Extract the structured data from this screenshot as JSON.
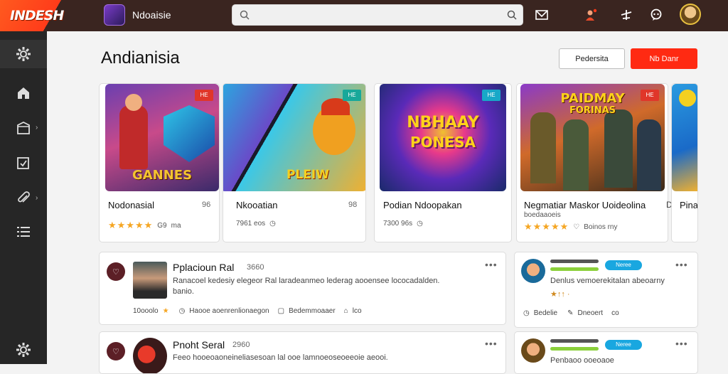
{
  "header": {
    "logo_text": "INDESH",
    "app_name": "Ndoaisie",
    "search": {
      "placeholder": ""
    }
  },
  "sidebar": {
    "items": [
      {
        "icon": "gear-icon"
      },
      {
        "icon": "home-icon"
      },
      {
        "icon": "folder-icon"
      },
      {
        "icon": "tasks-icon"
      },
      {
        "icon": "paperclip-icon"
      },
      {
        "icon": "list-icon"
      },
      {
        "icon": "settings-icon"
      }
    ]
  },
  "page": {
    "title": "Andianisia",
    "btn_secondary": "Pedersita",
    "btn_primary": "Nb Danr"
  },
  "cards": [
    {
      "title": "Nodonasial",
      "num": "96",
      "badge": "HE",
      "badge_color": "#e0362a",
      "art": "GANNES",
      "rating_label": "G9",
      "meta": "ma",
      "stars": "★★★★★"
    },
    {
      "title": "Nkooatian",
      "num": "98",
      "badge": "HE",
      "badge_color": "#18a89a",
      "art": "PLEIW",
      "meta": "7961 eos"
    },
    {
      "title": "Podian Ndoopakan",
      "badge": "HE",
      "badge_color": "#18a8c8",
      "art_line1": "NBHAAY",
      "art_line2": "PONESA",
      "meta": "7300 96s"
    },
    {
      "title": "Negmatiar Maskor Uoideolina",
      "sub": "boedaaoeis",
      "num": "D",
      "badge": "HE",
      "badge_color": "#e0362a",
      "art_line1": "PAIDMAY",
      "art_line2": "FORINAS",
      "meta": "Boinos rny",
      "stars": "★★★★★"
    },
    {
      "title": "Pina"
    }
  ],
  "posts": [
    {
      "title": "Pplacioun Ral",
      "num": "3660",
      "text_line1": "Ranacoel kedesiy elegeor Ral laradeanmeo lederag aooensee lococadalden.",
      "text_line2": "banio.",
      "stat": "10ooolo",
      "action1": "Haooe aoenrenlionaegon",
      "action2": "Bedemmoaaer",
      "action3": "lco"
    },
    {
      "title": "Pnoht Seral",
      "num": "2960",
      "text_line1": "Feeo hooeoaoneineliasesoan lal ooe lamnoeoseoeeoie aeooi."
    }
  ],
  "side_posts": [
    {
      "tag": "Neree",
      "text": "Denlus vemoerekitalan abeoarny",
      "reacts": "★↑↑ ·",
      "action1": "Bedelie",
      "action2": "Dneoert",
      "action3": "co"
    },
    {
      "tag": "Neree",
      "text": "Penbaoo ooeoaoe"
    }
  ]
}
